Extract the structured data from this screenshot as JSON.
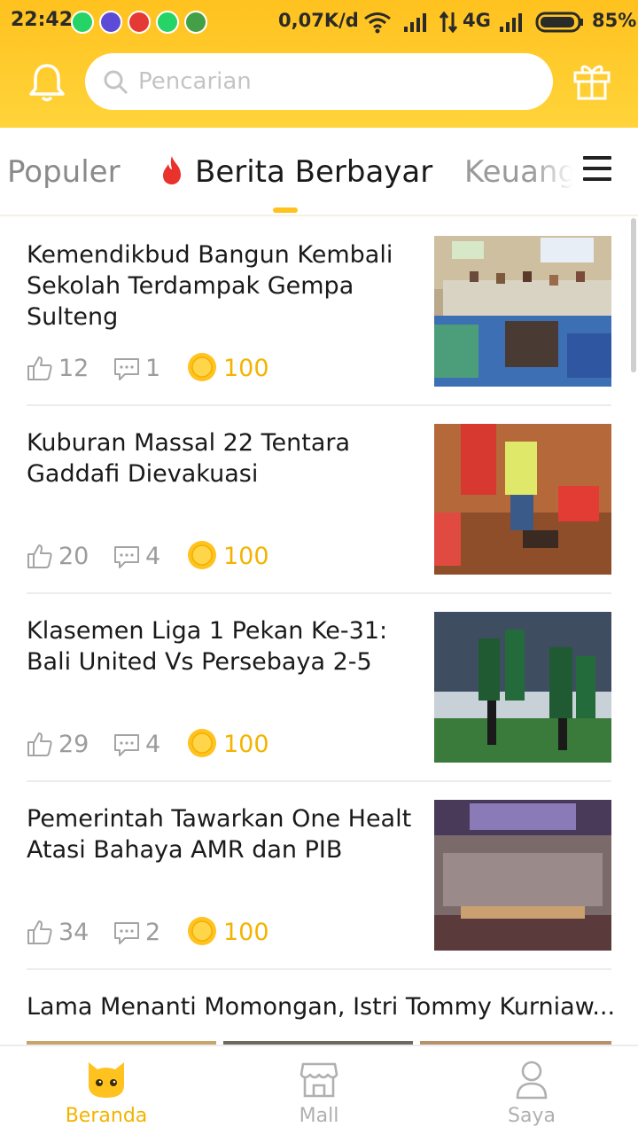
{
  "statusbar": {
    "time": "22:42",
    "speed": "0,07K/d",
    "network": "4G",
    "battery": "85%",
    "notif_icons": [
      "whatsapp-icon",
      "game-icon",
      "video-icon",
      "whatsapp-icon",
      "cat-icon"
    ]
  },
  "header": {
    "search_placeholder": "Pencarian"
  },
  "tabs": {
    "items": [
      "Populer",
      "Berita Berbayar",
      "Keuangan"
    ],
    "active": "Berita Berbayar"
  },
  "articles": [
    {
      "title": "Kemendikbud Bangun Kembali Sekolah Terdampak Gempa Sulteng",
      "likes": "12",
      "comments": "1",
      "coins": "100",
      "image": "classroom-photo"
    },
    {
      "title": "Kuburan Massal 22 Tentara Gaddafi Dievakuasi",
      "likes": "20",
      "comments": "4",
      "coins": "100",
      "image": "excavation-photo"
    },
    {
      "title": "Klasemen Liga 1 Pekan Ke-31: Bali United Vs Persebaya 2-5",
      "likes": "29",
      "comments": "4",
      "coins": "100",
      "image": "football-photo"
    },
    {
      "title": "Pemerintah Tawarkan One Healt Atasi Bahaya AMR dan PIB",
      "likes": "34",
      "comments": "2",
      "coins": "100",
      "image": "conference-photo"
    },
    {
      "title": "Lama Menanti Momongan, Istri Tommy Kurniaw..."
    }
  ],
  "bottom_nav": {
    "items": [
      "Beranda",
      "Mall",
      "Saya"
    ],
    "active": "Beranda"
  },
  "colors": {
    "accent": "#ffc21f",
    "coin": "#f3b400",
    "muted": "#9c9c9c"
  }
}
